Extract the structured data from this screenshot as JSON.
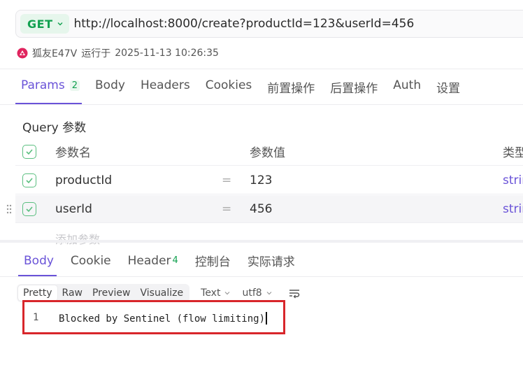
{
  "request": {
    "method": "GET",
    "url": "http://localhost:8000/create?productId=123&userId=456"
  },
  "run_info": {
    "user": "狐友E47V",
    "label": "运行于",
    "timestamp": "2025-11-13 10:26:35"
  },
  "request_tabs": [
    {
      "label": "Params",
      "count": "2"
    },
    {
      "label": "Body"
    },
    {
      "label": "Headers"
    },
    {
      "label": "Cookies"
    },
    {
      "label": "前置操作"
    },
    {
      "label": "后置操作"
    },
    {
      "label": "Auth"
    },
    {
      "label": "设置"
    }
  ],
  "query": {
    "title": "Query 参数",
    "headers": {
      "name": "参数名",
      "value": "参数值",
      "type": "类型"
    },
    "rows": [
      {
        "name": "productId",
        "eq": "=",
        "value": "123",
        "type": "strin"
      },
      {
        "name": "userId",
        "eq": "=",
        "value": "456",
        "type": "strin"
      }
    ],
    "add_placeholder": "添加参数",
    "more": "..."
  },
  "response_tabs": [
    {
      "label": "Body"
    },
    {
      "label": "Cookie"
    },
    {
      "label": "Header",
      "count": "4"
    },
    {
      "label": "控制台"
    },
    {
      "label": "实际请求"
    }
  ],
  "view_modes": [
    "Pretty",
    "Raw",
    "Preview",
    "Visualize"
  ],
  "format": "Text",
  "encoding": "utf8",
  "response_body": {
    "line_number": "1",
    "text": "Blocked by Sentinel (flow limiting)"
  },
  "colors": {
    "accent": "#6a53d8",
    "method": "#12a150",
    "highlight_box": "#d8262b"
  },
  "icons": {
    "method_dropdown": "chevron-down-icon",
    "avatar": "user-avatar-icon",
    "checkbox": "check-icon",
    "drag": "drag-handle-icon",
    "wrap": "word-wrap-icon"
  }
}
